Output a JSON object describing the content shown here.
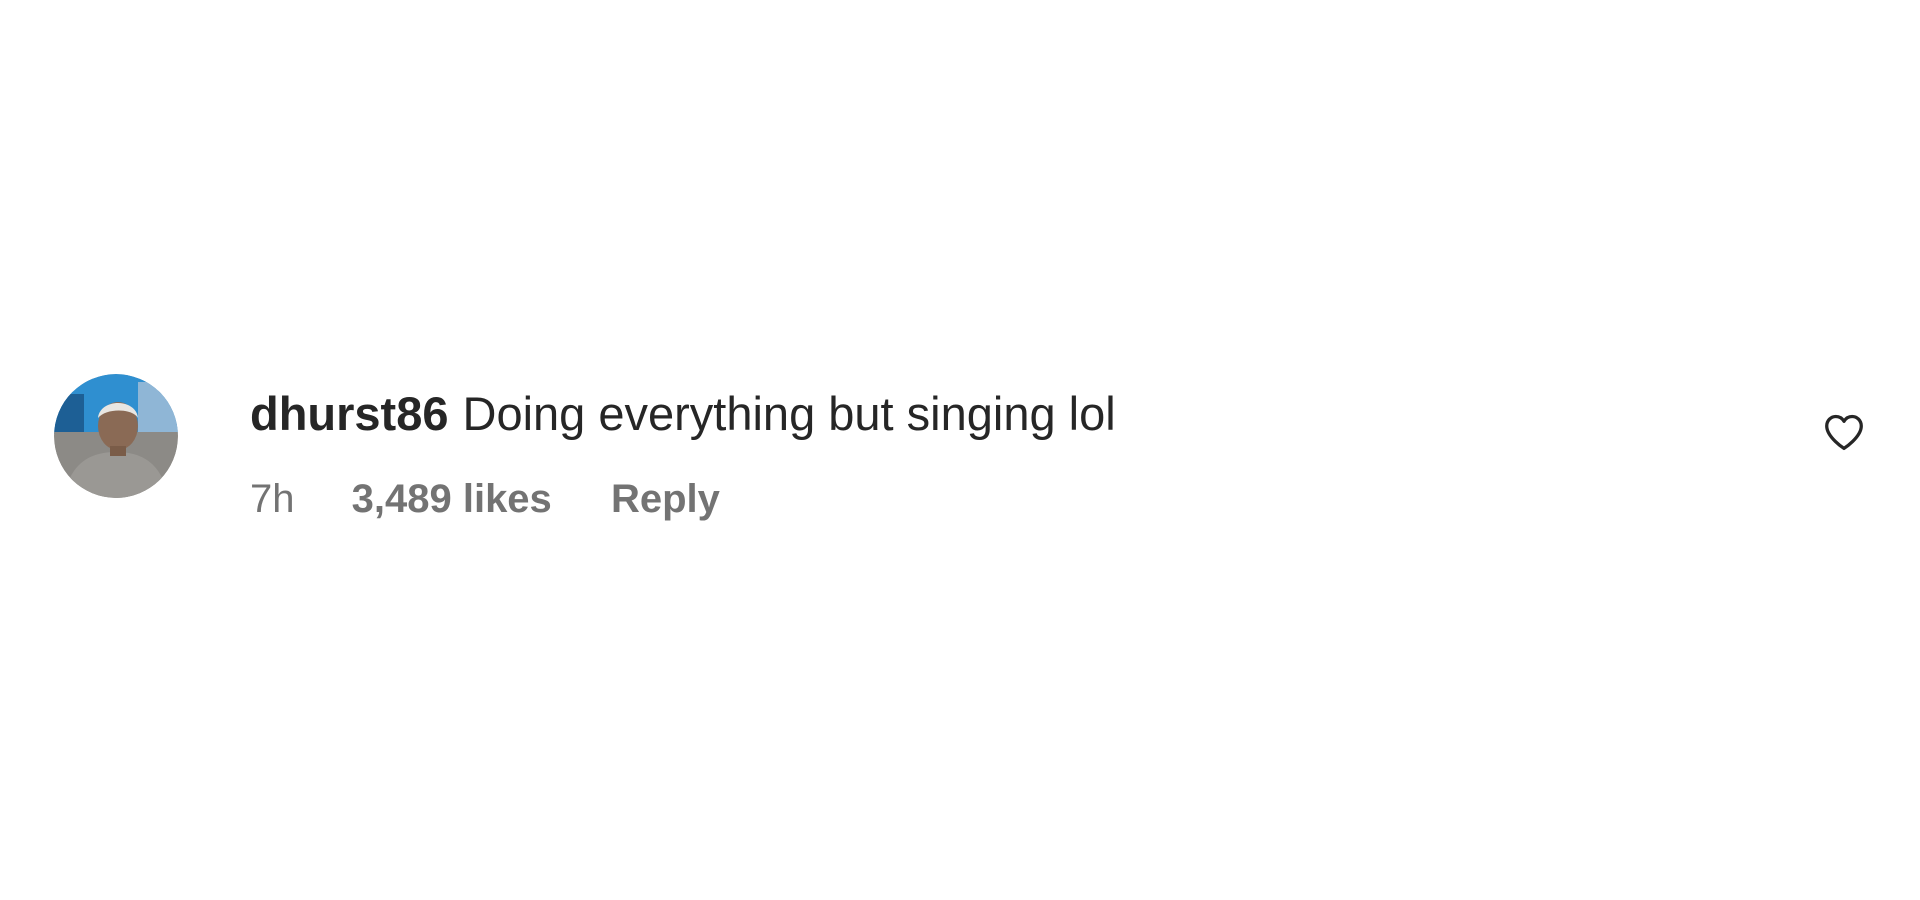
{
  "comment": {
    "username": "dhurst86",
    "text": "Doing everything but singing lol",
    "timestamp": "7h",
    "likes": "3,489 likes",
    "reply_label": "Reply",
    "like_icon": "heart-outline-icon"
  },
  "colors": {
    "primary_text": "#262626",
    "secondary_text": "#737373",
    "background": "#ffffff"
  }
}
